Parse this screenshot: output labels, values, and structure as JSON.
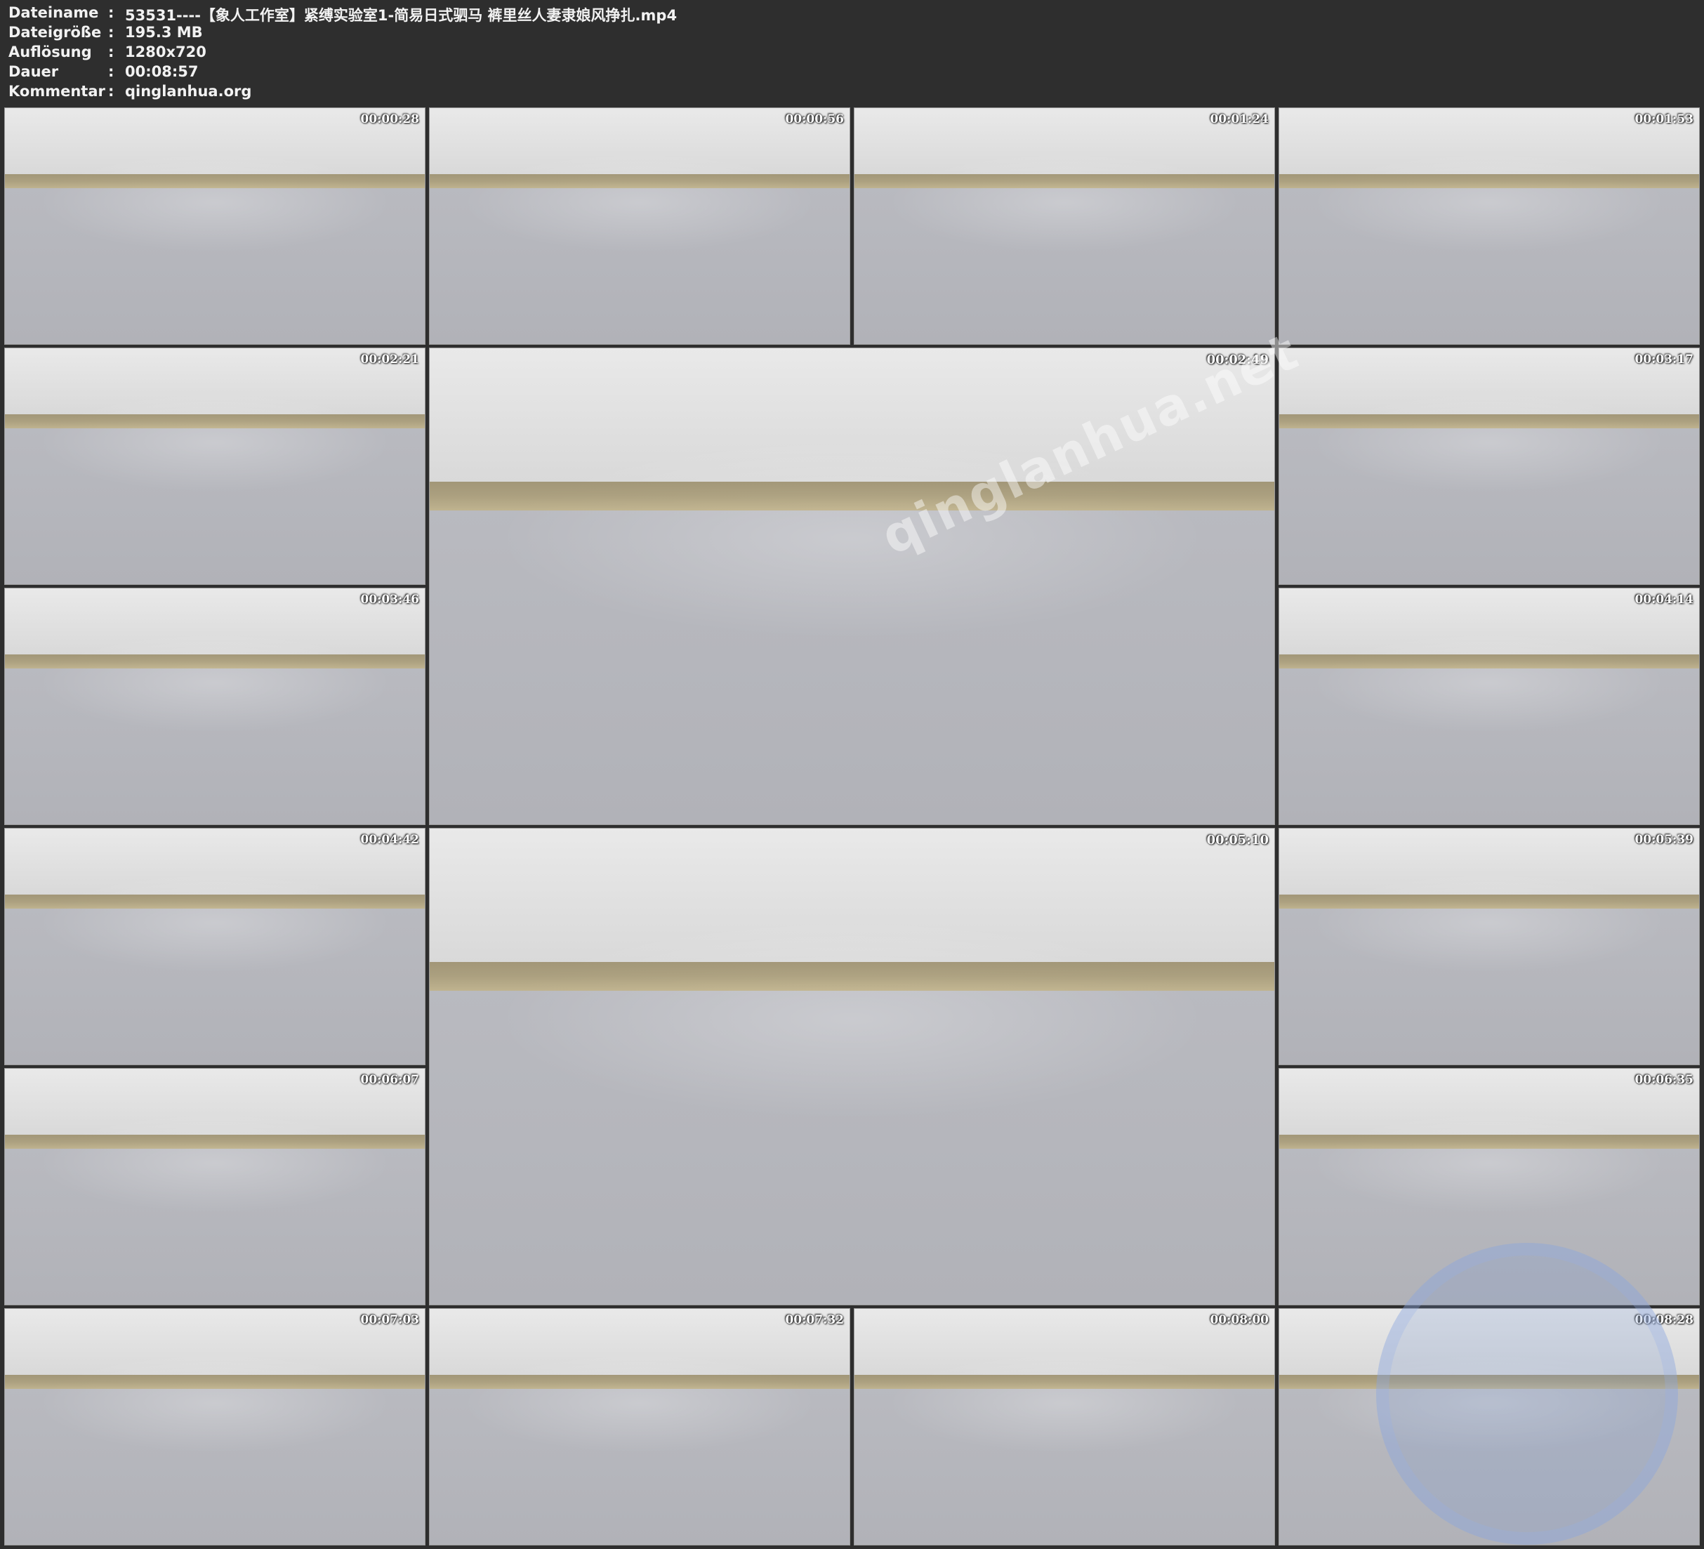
{
  "header": {
    "rows": [
      {
        "key": "Dateiname",
        "value": "53531----【象人工作室】紧缚实验室1-简易日式驷马 裤里丝人妻隶娘风挣扎.mp4"
      },
      {
        "key": "Dateigröße",
        "value": "195.3 MB"
      },
      {
        "key": "Auflösung",
        "value": "1280x720"
      },
      {
        "key": "Dauer",
        "value": "00:08:57"
      },
      {
        "key": "Kommentar",
        "value": "qinglanhua.org"
      }
    ],
    "separator": ":"
  },
  "thumbnails": [
    {
      "timestamp": "00:00:28"
    },
    {
      "timestamp": "00:00:56"
    },
    {
      "timestamp": "00:01:24"
    },
    {
      "timestamp": "00:01:53"
    },
    {
      "timestamp": "00:02:21"
    },
    {
      "timestamp": "00:02:49"
    },
    {
      "timestamp": "00:03:17"
    },
    {
      "timestamp": "00:03:46"
    },
    {
      "timestamp": "00:04:14"
    },
    {
      "timestamp": "00:04:42"
    },
    {
      "timestamp": "00:05:10"
    },
    {
      "timestamp": "00:05:39"
    },
    {
      "timestamp": "00:06:07"
    },
    {
      "timestamp": "00:06:35"
    },
    {
      "timestamp": "00:07:03"
    },
    {
      "timestamp": "00:07:32"
    },
    {
      "timestamp": "00:08:00"
    },
    {
      "timestamp": "00:08:28"
    }
  ],
  "watermark": {
    "text": "qinglanhua.net"
  },
  "colors": {
    "background": "#2e2e2e",
    "text": "#f2f2f2"
  }
}
